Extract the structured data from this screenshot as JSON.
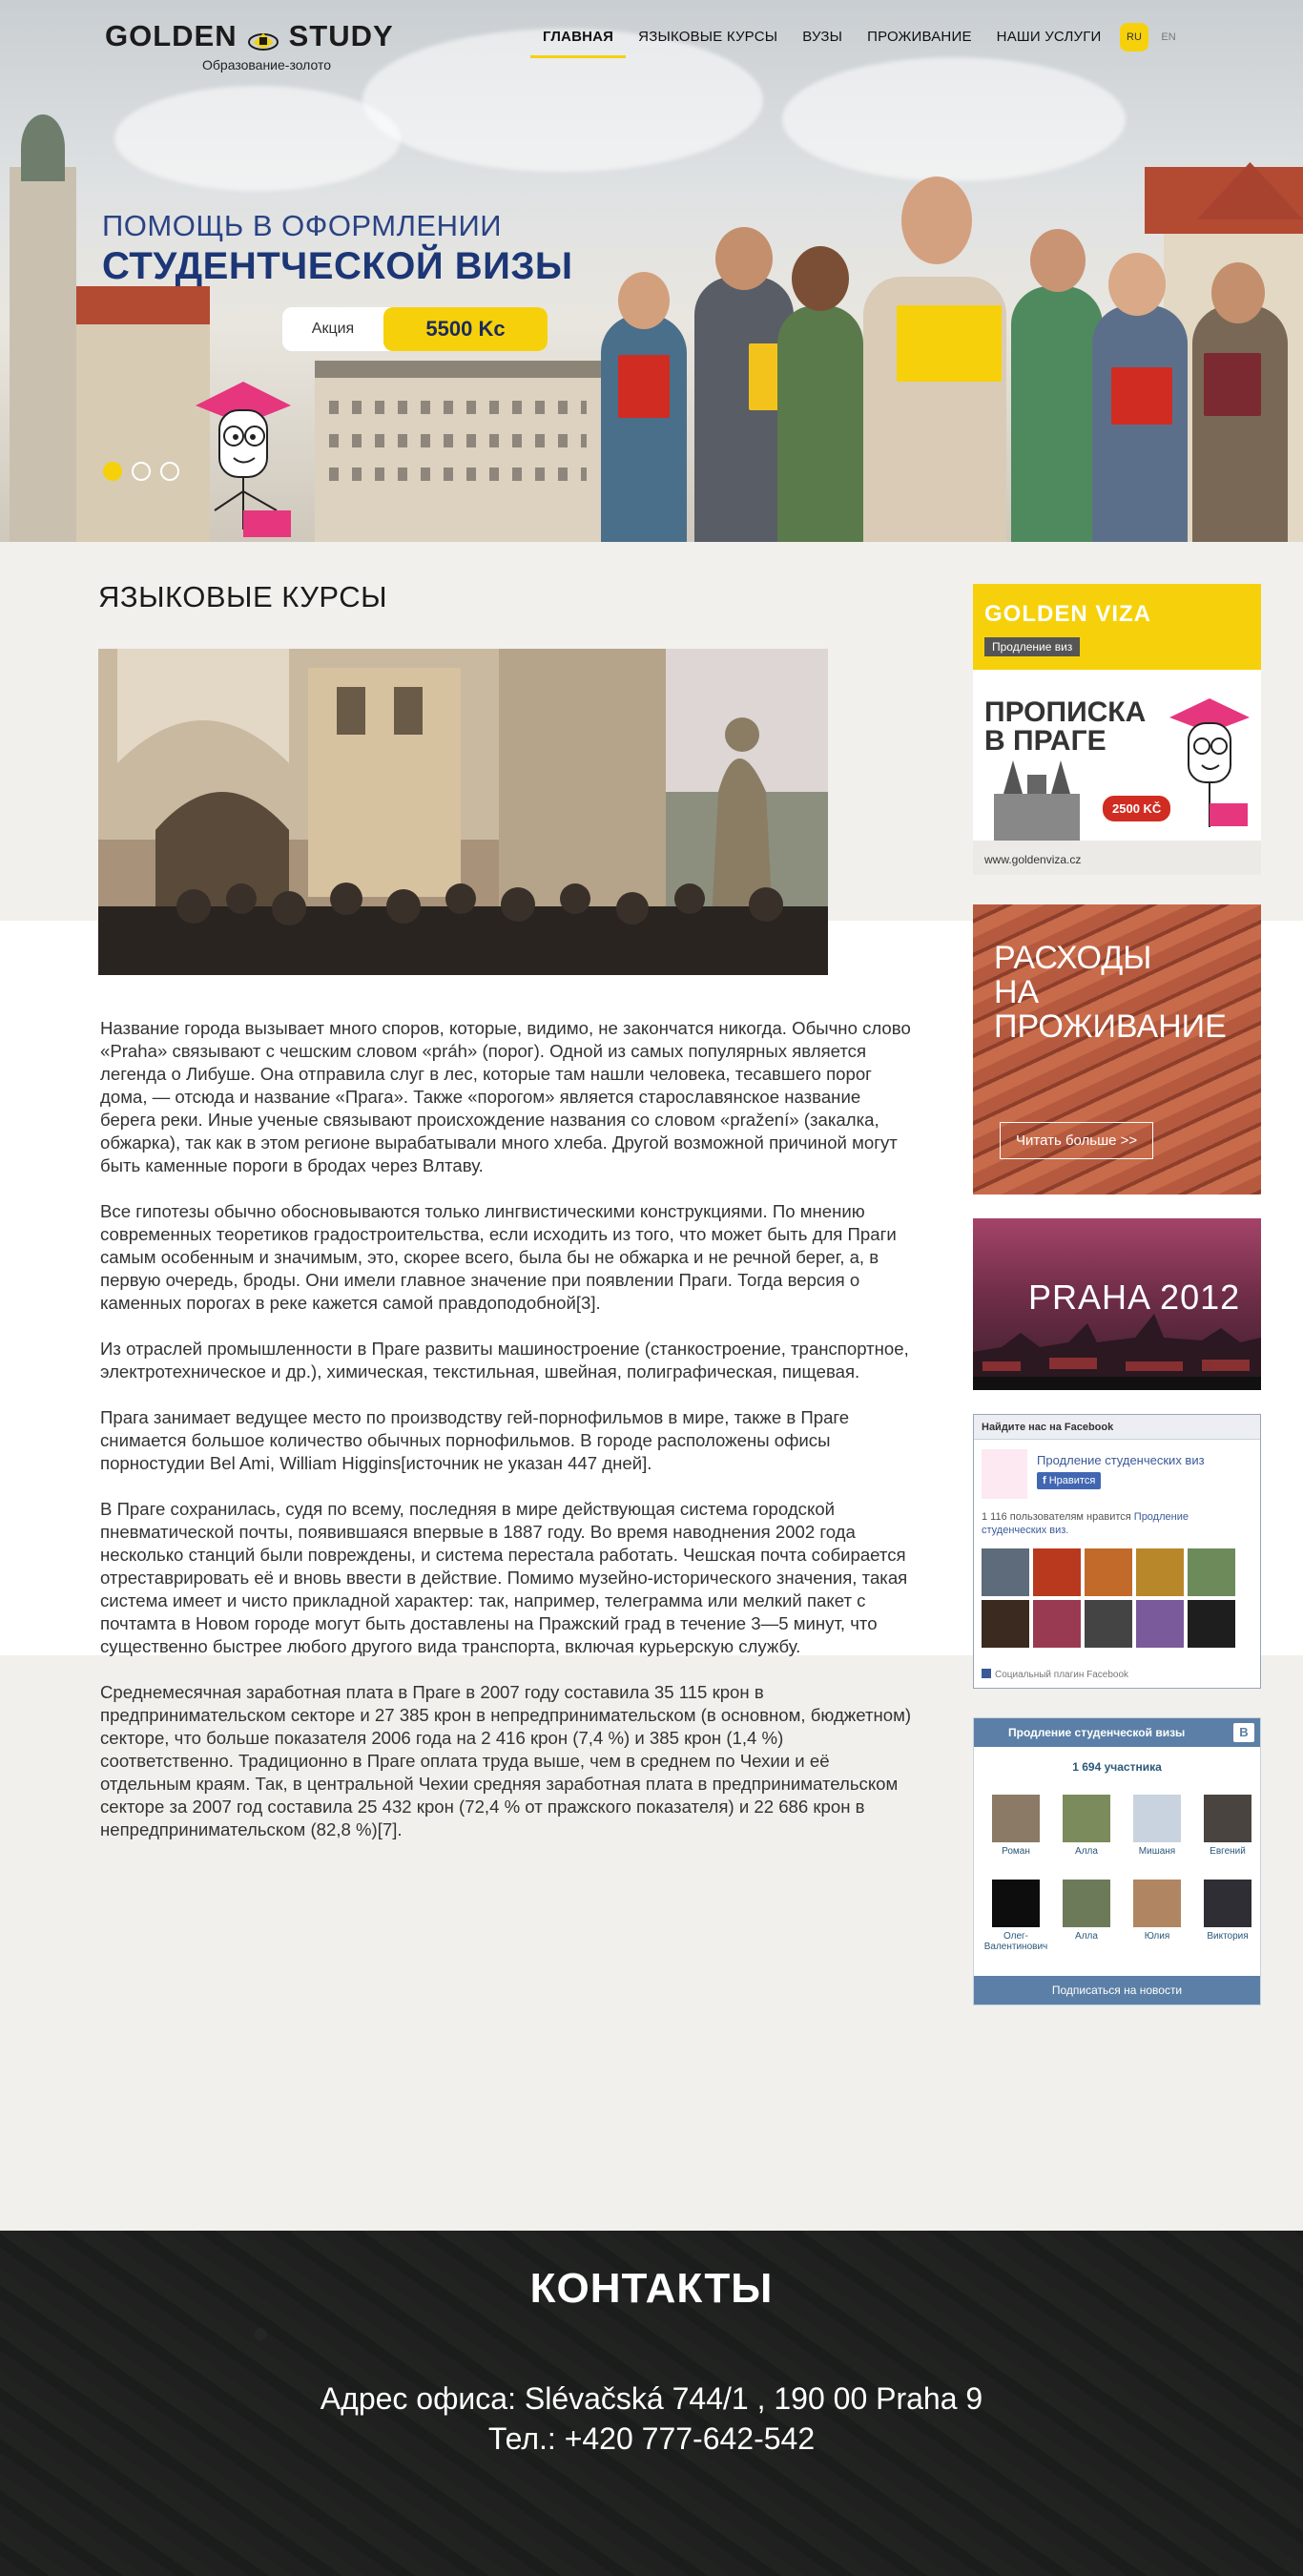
{
  "brand": {
    "logo_left": "GOLDEN",
    "logo_right": "STUDY",
    "tagline": "Образование-золото"
  },
  "nav": {
    "items": [
      {
        "label": "Главная",
        "active": true
      },
      {
        "label": "Языковые курсы",
        "active": false
      },
      {
        "label": "ВУЗы",
        "active": false
      },
      {
        "label": "Проживание",
        "active": false
      },
      {
        "label": "Наши услуги",
        "active": false
      }
    ],
    "lang": [
      "RU",
      "EN"
    ],
    "lang_active": "RU"
  },
  "hero": {
    "line1": "ПОМОЩЬ В ОФОРМЛЕНИИ",
    "line2": "СТУДЕНТЧЕСКОЙ ВИЗЫ",
    "promo_label": "Акция",
    "promo_price": "5500 Kc",
    "slides": 3,
    "active_slide": 1
  },
  "main": {
    "title": "ЯЗЫКОВЫЕ КУРСЫ",
    "paragraphs": [
      "Название города вызывает много споров, которые, видимо, не закончатся никогда. Обычно слово «Praha» связывают с чешским словом «práh» (порог). Одной из самых популярных является легенда о Либуше. Она отправила слуг в лес, которые там нашли человека, тесавшего порог дома, — отсюда и название «Прага». Также «порогом» является старославянское название берега реки. Иные ученые связывают происхождение названия со словом «pražení» (закалка, обжарка), так как в этом регионе вырабатывали много хлеба. Другой возможной причиной могут быть каменные пороги в бродах через Влтаву.",
      "Все гипотезы обычно обосновываются только лингвистическими конструкциями. По мнению современных теоретиков градостроительства, если исходить из того, что может быть для Праги самым особенным и значимым, это, скорее всего, была бы не обжарка и не речной берег, а, в первую очередь, броды. Они имели главное значение при появлении Праги. Тогда версия о каменных порогах в реке кажется самой правдоподобной[3].",
      "Из отраслей промышленности в Праге развиты машиностроение (станкостроение, транспортное, электротехническое и др.), химическая, текстильная, швейная, полиграфическая, пищевая.",
      "Прага занимает ведущее место по производству гей-порнофильмов в мире, также в Праге снимается большое количество обычных порнофильмов. В городе расположены офисы порностудии Bel Ami, William Higgins[источник не указан 447 дней].",
      "В Праге сохранилась, судя по всему, последняя в мире действующая система городской пневматической почты, появившаяся впервые в 1887 году. Во время наводнения 2002 года несколько станций были повреждены, и система перестала работать. Чешская почта собирается отреставрировать её и вновь ввести в действие. Помимо музейно-исторического значения, такая система имеет и чисто прикладной характер: так, например, телеграмма или мелкий пакет с почтамта в Новом городе могут быть доставлены на Пражский град в течение 3—5 минут, что существенно быстрее любого другого вида транспорта, включая курьерскую службу.",
      "Среднемесячная заработная плата в Праге в 2007 году составила 35 115 крон в предпринимательском секторе и 27 385 крон в непредпринимательском (в основном, бюджетном) секторе, что больше показателя 2006 года на 2 416 крон (7,4 %) и 385 крон (1,4 %) соответственно. Традиционно в Праге оплата труда выше, чем в среднем по Чехии и её отдельным краям. Так, в центральной Чехии средняя заработная плата в предпринимательском секторе за 2007 год составила 25 432 крон (72,4 % от пражского показателя) и 22 686 крон в непредпринимательском (82,8 %)[7]."
    ]
  },
  "sidebar": {
    "viza": {
      "brand": "GOLDEN VIZA",
      "chip": "Продление виз",
      "headline_1": "ПРОПИСКА",
      "headline_2": "В ПРАГЕ",
      "price": "2500 KČ",
      "url": "www.goldenviza.cz"
    },
    "rashod": {
      "title_1": "РАСХОДЫ",
      "title_2": "НА",
      "title_3": "ПРОЖИВАНИЕ",
      "button": "Читать больше >>"
    },
    "video": {
      "title": "PRAHA 2012"
    },
    "facebook": {
      "header": "Найдите нас на Facebook",
      "page_name": "Продление студенческих виз",
      "like": "Нравится",
      "count_text": "1 116 пользователям нравится",
      "count_link": "Продление студенческих виз.",
      "plugin": "Социальный плагин Facebook",
      "tiles": [
        "#5d6b7a",
        "#b8391e",
        "#c26a2a",
        "#b8872a",
        "#6c8a5a",
        "#3a2a20",
        "#9a3a52",
        "#444444",
        "#7a5a9a",
        "#1e1e1e"
      ]
    },
    "vk": {
      "header": "Продление студенческой визы",
      "icon": "В",
      "count": "1 694 участника",
      "members": [
        {
          "name": "Роман",
          "color": "#8a7a66"
        },
        {
          "name": "Алла",
          "color": "#7b8b5c"
        },
        {
          "name": "Мишаня",
          "color": "#c9d3e0"
        },
        {
          "name": "Евгений",
          "color": "#4a4440"
        },
        {
          "name": "Олег-Валентинович",
          "color": "#0d0d0d"
        },
        {
          "name": "Алла",
          "color": "#6c7a5a"
        },
        {
          "name": "Юлия",
          "color": "#b08662"
        },
        {
          "name": "Виктория",
          "color": "#2e2e34"
        }
      ],
      "subscribe": "Подписаться на новости"
    }
  },
  "footer": {
    "title": "КОНТАКТЫ",
    "address": "Адрес офиса: Slévačská 744/1 , 190 00 Praha 9",
    "phone": "Тел.: +420 777-642-542"
  }
}
